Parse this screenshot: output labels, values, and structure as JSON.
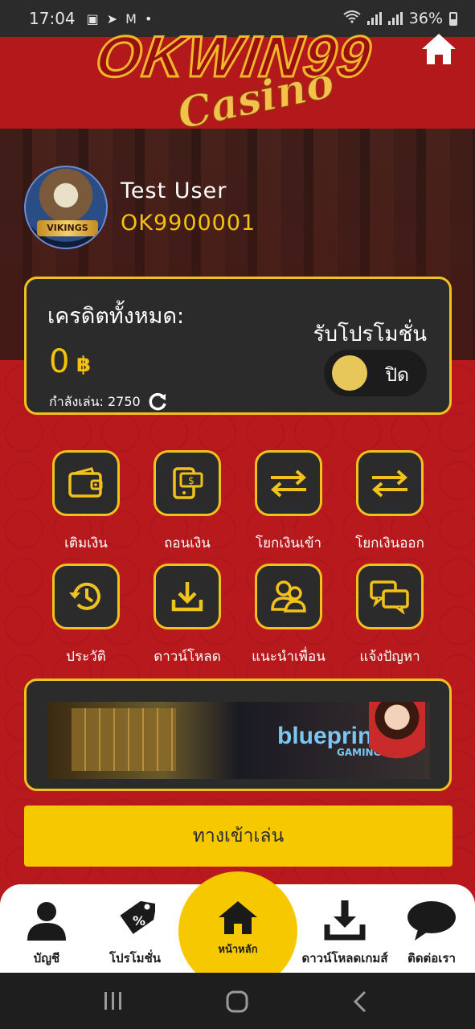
{
  "status_bar": {
    "time": "17:04",
    "battery": "36%"
  },
  "header": {
    "logo_main": "OKWIN99",
    "logo_script": "Casino"
  },
  "user": {
    "name": "Test User",
    "id": "OK9900001",
    "avatar_text": "VIKINGS"
  },
  "credit": {
    "label": "เครดิตทั้งหมด:",
    "amount": "0",
    "currency_symbol": "฿",
    "playing_label": "กำลังเล่น: 2750",
    "promo_label": "รับโปรโมชั่น",
    "promo_state": "ปิด"
  },
  "menu": [
    {
      "label": "เติมเงิน",
      "icon": "wallet-icon"
    },
    {
      "label": "ถอนเงิน",
      "icon": "mobile-money-icon"
    },
    {
      "label": "โยกเงินเข้า",
      "icon": "transfer-icon"
    },
    {
      "label": "โยกเงินออก",
      "icon": "transfer-icon"
    },
    {
      "label": "ประวัติ",
      "icon": "history-icon"
    },
    {
      "label": "ดาวน์โหลด",
      "icon": "download-icon"
    },
    {
      "label": "แนะนำเพื่อน",
      "icon": "users-icon"
    },
    {
      "label": "แจ้งปัญหา",
      "icon": "chat-icon"
    }
  ],
  "banner": {
    "brand": "blueprint",
    "brand_sub": "GAMING"
  },
  "play_button": {
    "label": "ทางเข้าเล่น"
  },
  "bottom_nav": {
    "account": "บัญชี",
    "promotion": "โปรโมชั่น",
    "home": "หน้าหลัก",
    "download_game": "ดาวน์โหลดเกมส์",
    "contact": "ติดต่อเรา"
  },
  "colors": {
    "accent": "#f5c800",
    "background": "#b8191c",
    "card": "#2b2b2b"
  }
}
